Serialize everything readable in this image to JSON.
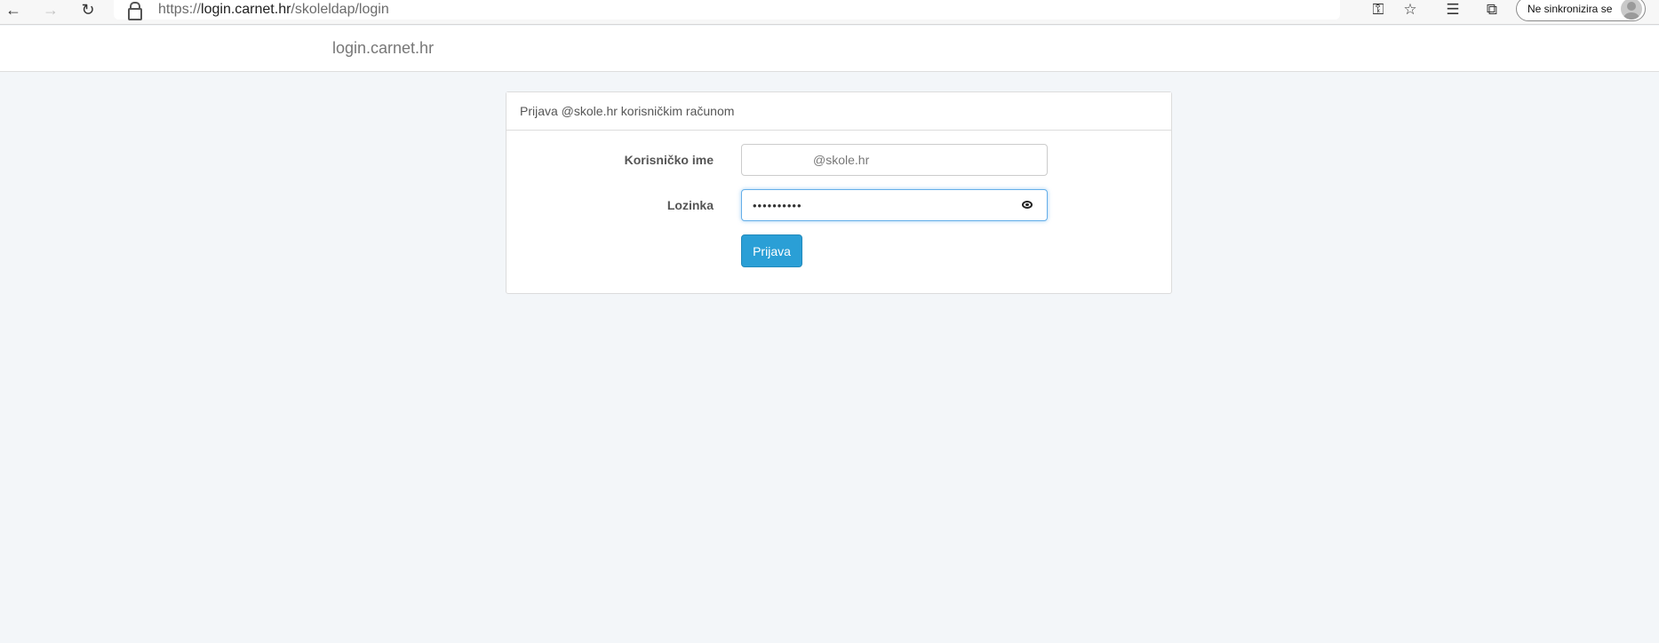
{
  "browser": {
    "back_icon": "←",
    "forward_icon": "→",
    "reload_icon": "↻",
    "url_scheme": "https://",
    "url_host": "login.carnet.hr",
    "url_path": "/skoleldap/login",
    "key_icon": "⚿",
    "star_icon": "☆",
    "favorites_icon": "☰",
    "collections_icon": "⧉",
    "profile_label": "Ne sinkronizira se"
  },
  "site": {
    "brand": "login.carnet.hr"
  },
  "login": {
    "heading": "Prijava @skole.hr korisničkim računom",
    "username_label": "Korisničko ime",
    "username_suffix": "@skole.hr",
    "password_label": "Lozinka",
    "password_mask": "••••••••••",
    "submit_label": "Prijava"
  }
}
